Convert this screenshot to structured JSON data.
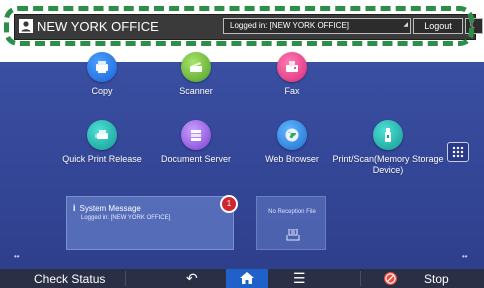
{
  "header": {
    "office_name": "NEW YORK OFFICE",
    "login_status": "Logged in: [NEW YORK OFFICE]",
    "logout_label": "Logout",
    "night_mode_icon": "moon-icon"
  },
  "apps": [
    {
      "label": "Copy",
      "icon": "copy-icon"
    },
    {
      "label": "Scanner",
      "icon": "scanner-icon"
    },
    {
      "label": "Fax",
      "icon": "fax-icon"
    },
    {
      "label": "Quick Print Release",
      "icon": "quick-print-icon"
    },
    {
      "label": "Document Server",
      "icon": "document-server-icon"
    },
    {
      "label": "Web Browser",
      "icon": "globe-icon"
    },
    {
      "label": "Print/Scan(Memory Storage Device)",
      "icon": "usb-icon"
    }
  ],
  "system_message": {
    "title": "System Message",
    "body": "Logged in: [NEW YORK OFFICE]",
    "badge_count": "1"
  },
  "reception": {
    "text": "No Reception File"
  },
  "footer": {
    "check_status": "Check Status",
    "stop": "Stop"
  },
  "colors": {
    "highlight_dashed": "#2b8f4a",
    "background": "#36499b",
    "home_active": "#1f61c8",
    "stop": "#e84b3c"
  }
}
